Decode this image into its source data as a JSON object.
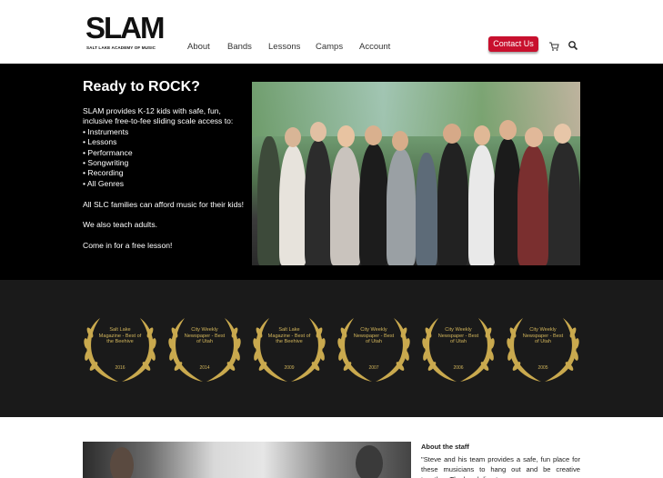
{
  "header": {
    "logo": {
      "word": "SLAM",
      "subtitle": "SALT LAKE ACADEMY OF MUSIC"
    },
    "nav": [
      {
        "label": "About"
      },
      {
        "label": "Bands"
      },
      {
        "label": "Lessons"
      },
      {
        "label": "Camps"
      },
      {
        "label": "Account"
      }
    ],
    "contact_label": "Contact Us",
    "icons": [
      "cart-icon",
      "search-icon"
    ]
  },
  "hero": {
    "title": "Ready to ROCK?",
    "intro": "SLAM provides K-12 kids with safe, fun, inclusive free-to-fee sliding scale access to:",
    "bullets": [
      "• Instruments",
      "• Lessons",
      "• Performance",
      "• Songwriting",
      "• Recording",
      "• All Genres"
    ],
    "families": "All SLC families can afford music for their kids!",
    "adults": "We also teach adults.",
    "cta": "Come in for a free lesson!"
  },
  "awards": [
    {
      "text": "Salt Lake Magazine - Best of the Beehive",
      "year": "2016"
    },
    {
      "text": "City Weekly Newspaper - Best of Utah",
      "year": "2014"
    },
    {
      "text": "Salt Lake Magazine - Best of the Beehive",
      "year": "2009"
    },
    {
      "text": "City Weekly Newspaper - Best of Utah",
      "year": "2007"
    },
    {
      "text": "City Weekly Newspaper - Best of Utah",
      "year": "2006"
    },
    {
      "text": "City Weekly Newspaper - Best of Utah",
      "year": "2005"
    }
  ],
  "staff": {
    "title": "About the staff",
    "quote": "\"Steve and his team provides a safe, fun place for these musicians to hang out and be creative together. The band directors are"
  },
  "colors": {
    "accent": "#c8102e",
    "gold": "#d2b55b",
    "hero_bg": "#000000",
    "awards_bg": "#1a1a1a"
  }
}
